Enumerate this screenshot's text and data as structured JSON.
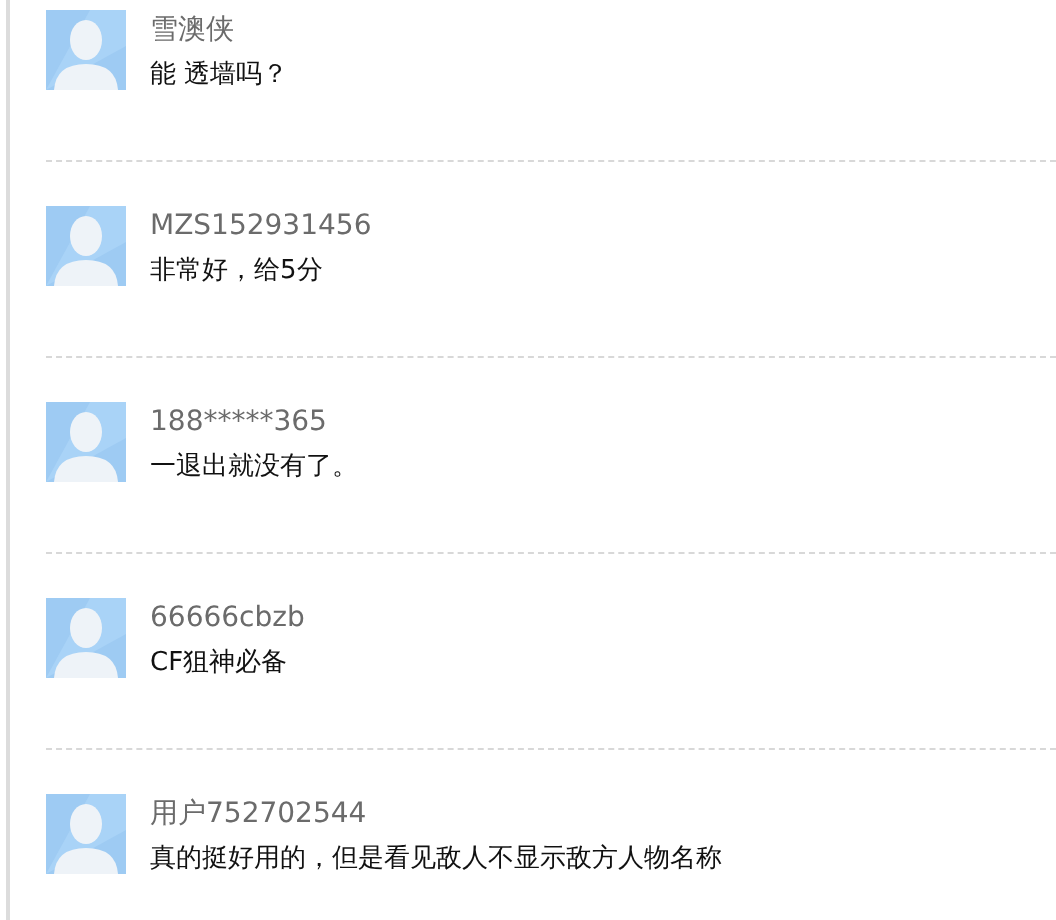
{
  "comments": [
    {
      "user": "雪澳侠",
      "text": "能 透墙吗？"
    },
    {
      "user": "MZS152931456",
      "text": "非常好，给5分"
    },
    {
      "user": "188*****365",
      "text": "一退出就没有了。"
    },
    {
      "user": "66666cbzb",
      "text": "CF狙神必备"
    },
    {
      "user": "用户752702544",
      "text": "真的挺好用的，但是看见敌人不显示敌方人物名称"
    }
  ]
}
